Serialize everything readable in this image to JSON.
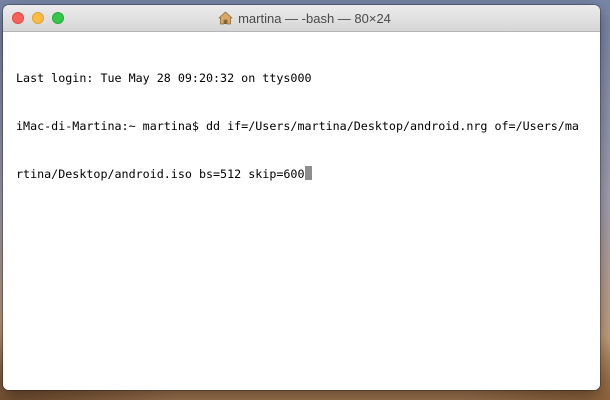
{
  "window": {
    "title": "martina — -bash — 80×24",
    "title_icon": "home-icon"
  },
  "terminal": {
    "lines": [
      "Last login: Tue May 28 09:20:32 on ttys000",
      "iMac-di-Martina:~ martina$ dd if=/Users/martina/Desktop/android.nrg of=/Users/ma",
      "rtina/Desktop/android.iso bs=512 skip=600"
    ],
    "cursor": "block-cursor"
  },
  "colors": {
    "close": "#fc605b",
    "minimize": "#fdbc40",
    "maximize": "#34c84a",
    "terminal_bg": "#ffffff",
    "terminal_fg": "#000000",
    "cursor": "#8e8e8e"
  }
}
